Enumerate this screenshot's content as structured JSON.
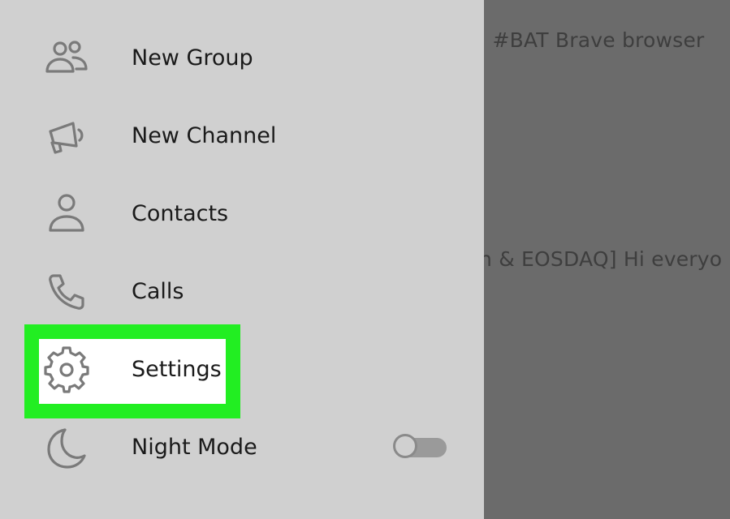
{
  "menu": {
    "items": [
      {
        "label": "New Group",
        "icon": "group-icon"
      },
      {
        "label": "New Channel",
        "icon": "megaphone-icon"
      },
      {
        "label": "Contacts",
        "icon": "person-icon"
      },
      {
        "label": "Calls",
        "icon": "phone-icon"
      },
      {
        "label": "Settings",
        "icon": "gear-icon"
      },
      {
        "label": "Night Mode",
        "icon": "moon-icon"
      }
    ],
    "highlighted": "Settings",
    "night_mode_enabled": false
  },
  "background_chats": {
    "line1": "ll #BAT  Brave browser",
    "line2": "n & EOSDAQ]  Hi everyo"
  },
  "colors": {
    "highlight": "#22ee22",
    "sidebar_bg": "#d0d0d0",
    "overlay_bg": "#6b6b6b"
  }
}
